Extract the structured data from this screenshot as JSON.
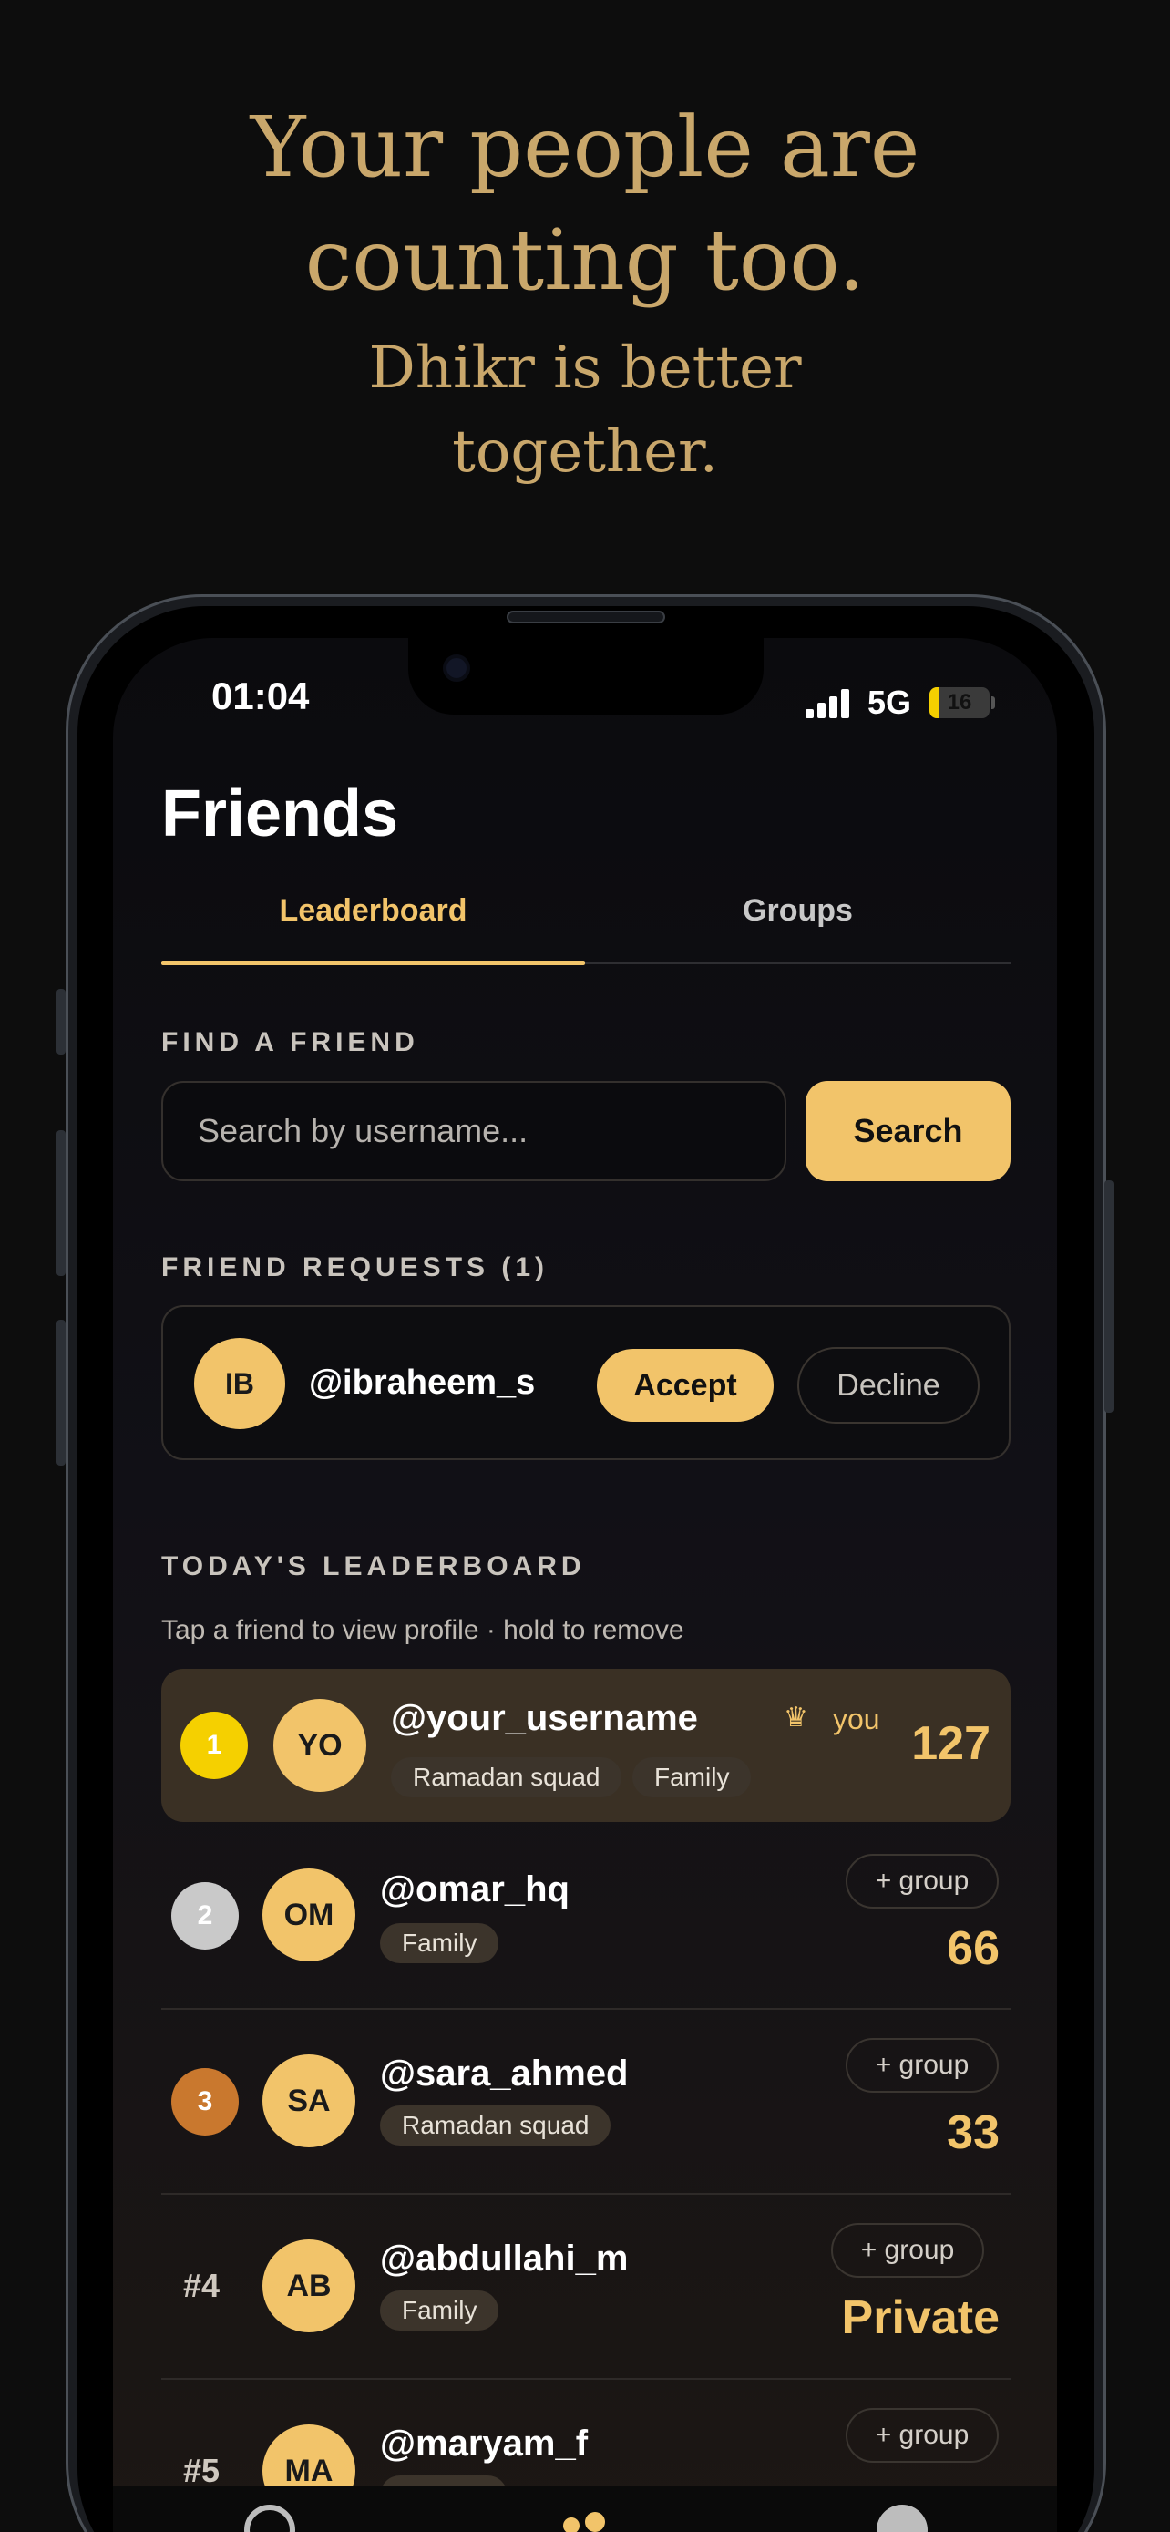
{
  "hero": {
    "title_line1": "Your people are",
    "title_line2": "counting too.",
    "sub_line1": "Dhikr is better",
    "sub_line2": "together."
  },
  "status_bar": {
    "time": "01:04",
    "network": "5G",
    "battery": "16",
    "battery_level": 0.16
  },
  "page": {
    "title": "Friends"
  },
  "tabs": [
    {
      "label": "Leaderboard",
      "active": true
    },
    {
      "label": "Groups",
      "active": false
    }
  ],
  "find_friend": {
    "label": "FIND A FRIEND",
    "placeholder": "Search by username...",
    "value": "",
    "button": "Search"
  },
  "requests": {
    "label": "FRIEND REQUESTS (1)",
    "items": [
      {
        "initials": "IB",
        "username": "@ibraheem_s",
        "accept": "Accept",
        "decline": "Decline"
      }
    ]
  },
  "leaderboard": {
    "label": "TODAY'S LEADERBOARD",
    "hint": "Tap a friend to view profile · hold to remove",
    "you_label": "you",
    "group_button": "+ group",
    "rows": [
      {
        "rank": "1",
        "initials": "YO",
        "username": "@your_username",
        "tags": [
          "Ramadan squad",
          "Family"
        ],
        "score": "127",
        "is_you": true,
        "rank_color": "#f5d000"
      },
      {
        "rank": "2",
        "initials": "OM",
        "username": "@omar_hq",
        "tags": [
          "Family"
        ],
        "score": "66",
        "rank_color": "#c9c9c9"
      },
      {
        "rank": "3",
        "initials": "SA",
        "username": "@sara_ahmed",
        "tags": [
          "Ramadan squad"
        ],
        "score": "33",
        "rank_color": "#c9782e"
      },
      {
        "rank": "#4",
        "initials": "AB",
        "username": "@abdullahi_m",
        "tags": [
          "Family"
        ],
        "score": "Private"
      },
      {
        "rank": "#5",
        "initials": "MA",
        "username": "@maryam_f",
        "tags": [],
        "score": ""
      }
    ]
  },
  "colors": {
    "accent": "#f2c46a",
    "hero_text": "#c9a76b",
    "background": "#0d0d0d"
  }
}
